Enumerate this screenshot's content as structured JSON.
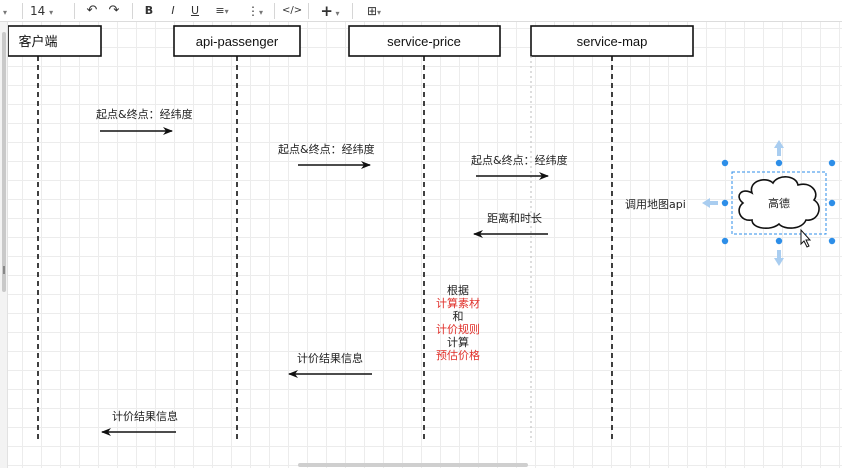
{
  "toolbar": {
    "font_size": "14",
    "icons": [
      "undo-icon",
      "redo-icon",
      "bold-icon",
      "italic-icon",
      "underline-icon",
      "align-icon",
      "vertical-align-icon",
      "html-code-icon",
      "insert-plus-icon",
      "table-icon"
    ],
    "bold": "B",
    "italic": "I",
    "underline": "U",
    "code": "</>",
    "insert": "+"
  },
  "participants": [
    {
      "id": "client",
      "label": "客户端"
    },
    {
      "id": "api-passenger",
      "label": "api-passenger"
    },
    {
      "id": "service-price",
      "label": "service-price"
    },
    {
      "id": "service-map",
      "label": "service-map"
    }
  ],
  "messages": [
    {
      "from": "client",
      "to": "api-passenger",
      "label": "起点&终点：经纬度"
    },
    {
      "from": "api-passenger",
      "to": "service-price",
      "label": "起点&终点：经纬度"
    },
    {
      "from": "service-price",
      "to": "service-map",
      "label": "起点&终点：经纬度"
    },
    {
      "from": "service-map",
      "to": "service-price",
      "label": "距离和时长"
    },
    {
      "from": "service-price",
      "to": "api-passenger",
      "label": "计价结果信息"
    },
    {
      "from": "api-passenger",
      "to": "client",
      "label": "计价结果信息"
    }
  ],
  "map_call": {
    "label": "调用地图api",
    "cloud_label": "高德"
  },
  "note": {
    "lines": [
      {
        "text": "根据",
        "highlight": false
      },
      {
        "text": "计算素材",
        "highlight": true
      },
      {
        "text": "和",
        "highlight": false
      },
      {
        "text": "计价规则",
        "highlight": true
      },
      {
        "text": "计算",
        "highlight": false
      },
      {
        "text": "预估价格",
        "highlight": true
      }
    ]
  },
  "colors": {
    "highlight": "#e0302a",
    "selection": "#2d8ee8",
    "arrow_hint": "#a9cdf0"
  }
}
